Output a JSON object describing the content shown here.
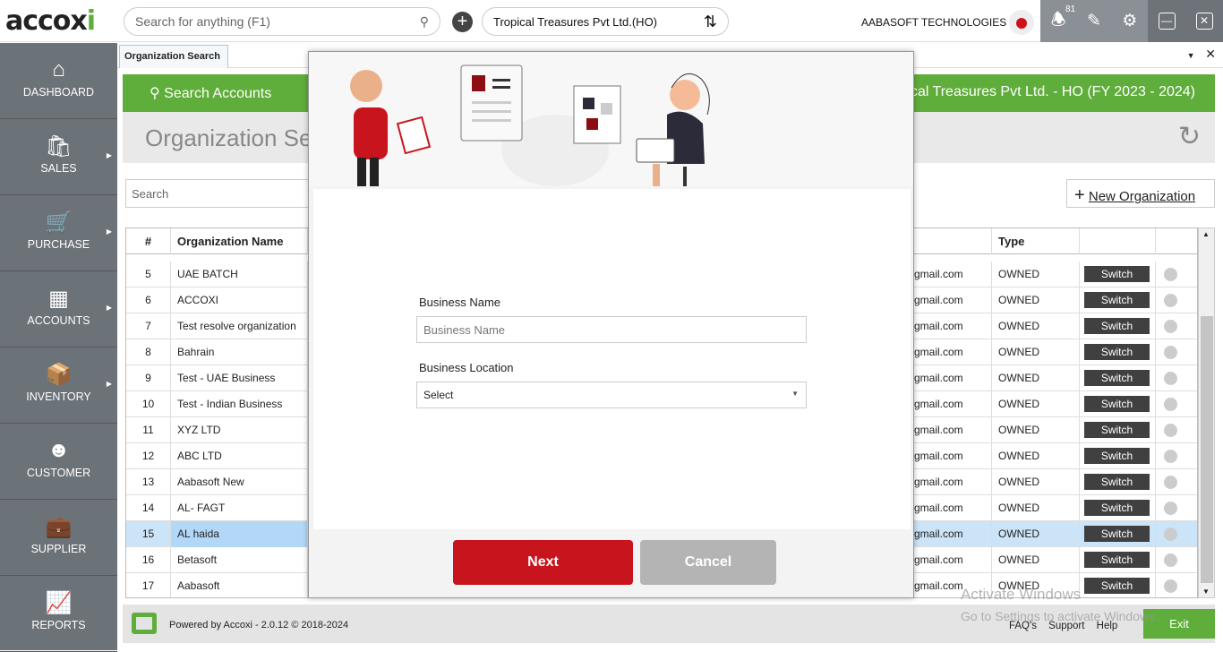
{
  "topbar": {
    "logo": "accoxi",
    "search_placeholder": "Search for anything (F1)",
    "company": "Tropical Treasures Pvt Ltd.(HO)",
    "org_name": "AABASOFT TECHNOLOGIES",
    "notification_count": "81"
  },
  "sidebar": {
    "items": [
      {
        "label": "DASHBOARD",
        "icon": "home-icon"
      },
      {
        "label": "SALES",
        "icon": "shopping-bag-icon"
      },
      {
        "label": "PURCHASE",
        "icon": "cart-icon"
      },
      {
        "label": "ACCOUNTS",
        "icon": "calculator-icon"
      },
      {
        "label": "INVENTORY",
        "icon": "inventory-icon"
      },
      {
        "label": "CUSTOMER",
        "icon": "user-icon"
      },
      {
        "label": "SUPPLIER",
        "icon": "briefcase-icon"
      },
      {
        "label": "REPORTS",
        "icon": "chart-icon"
      }
    ]
  },
  "tab": {
    "label": "Organization Search"
  },
  "header": {
    "search_accounts": "Search Accounts",
    "fy": "Tropical Treasures Pvt Ltd. - HO (FY 2023 - 2024)",
    "title": "Organization Search"
  },
  "toolbar": {
    "search_placeholder": "Search",
    "new_org": "New Organization"
  },
  "table": {
    "columns": [
      "#",
      "Organization Name",
      "",
      "Type",
      "",
      ""
    ],
    "rows": [
      {
        "n": "5",
        "name": "UAE BATCH",
        "email": "gmail.com",
        "type": "OWNED"
      },
      {
        "n": "6",
        "name": "ACCOXI",
        "email": "gmail.com",
        "type": "OWNED"
      },
      {
        "n": "7",
        "name": "Test resolve organization",
        "email": "gmail.com",
        "type": "OWNED"
      },
      {
        "n": "8",
        "name": "Bahrain",
        "email": "gmail.com",
        "type": "OWNED"
      },
      {
        "n": "9",
        "name": "Test - UAE Business",
        "email": "gmail.com",
        "type": "OWNED"
      },
      {
        "n": "10",
        "name": "Test - Indian Business",
        "email": "gmail.com",
        "type": "OWNED"
      },
      {
        "n": "11",
        "name": "XYZ LTD",
        "email": "gmail.com",
        "type": "OWNED"
      },
      {
        "n": "12",
        "name": "ABC LTD",
        "email": "gmail.com",
        "type": "OWNED"
      },
      {
        "n": "13",
        "name": "Aabasoft New",
        "email": "gmail.com",
        "type": "OWNED"
      },
      {
        "n": "14",
        "name": "AL- FAGT",
        "email": "gmail.com",
        "type": "OWNED"
      },
      {
        "n": "15",
        "name": "AL haida",
        "email": "gmail.com",
        "type": "OWNED",
        "selected": true
      },
      {
        "n": "16",
        "name": "Betasoft",
        "email": "gmail.com",
        "type": "OWNED"
      },
      {
        "n": "17",
        "name": "Aabasoft",
        "email": "gmail.com",
        "type": "OWNED"
      }
    ],
    "switch_label": "Switch"
  },
  "modal": {
    "business_name_label": "Business Name",
    "business_name_placeholder": "Business Name",
    "business_location_label": "Business Location",
    "business_location_value": "Select",
    "next": "Next",
    "cancel": "Cancel"
  },
  "footer": {
    "powered": "Powered by Accoxi - 2.0.12 © 2018-2024",
    "links": [
      "FAQ's",
      "Support",
      "Help"
    ],
    "exit": "Exit"
  },
  "watermark": {
    "line1": "Activate Windows",
    "line2": "Go to Settings to activate Windows."
  },
  "colors": {
    "green": "#5fad3a",
    "red": "#c8141c",
    "sidebar": "#6b7278"
  }
}
